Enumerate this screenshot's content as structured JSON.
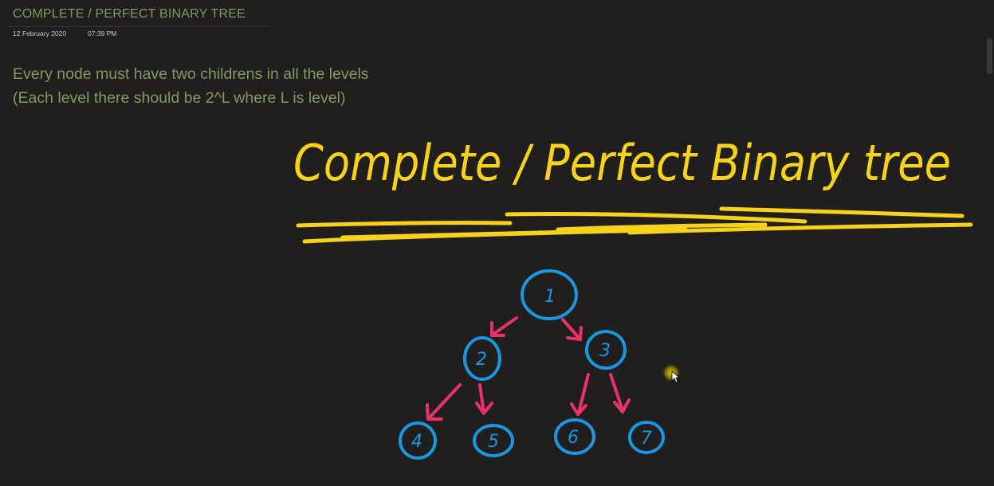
{
  "page": {
    "title": "COMPLETE / PERFECT BINARY TREE",
    "date": "12 February 2020",
    "time": "07:39 PM"
  },
  "note": {
    "line1": "Every node must have two childrens in all the levels",
    "line2": "(Each level there should be 2^L where L is level)"
  },
  "ink": {
    "heading": "Complete / Perfect Binary tree",
    "heading_color": "#f7d21c",
    "node_color": "#1a97e0",
    "arrow_color": "#e8336a",
    "nodes": [
      {
        "id": "n1",
        "label": "1"
      },
      {
        "id": "n2",
        "label": "2"
      },
      {
        "id": "n3",
        "label": "3"
      },
      {
        "id": "n4",
        "label": "4"
      },
      {
        "id": "n5",
        "label": "5"
      },
      {
        "id": "n6",
        "label": "6"
      },
      {
        "id": "n7",
        "label": "7"
      }
    ]
  },
  "colors": {
    "background": "#201f1d",
    "note_text": "#7f9b63",
    "cursor_highlight": "#f2d300"
  }
}
